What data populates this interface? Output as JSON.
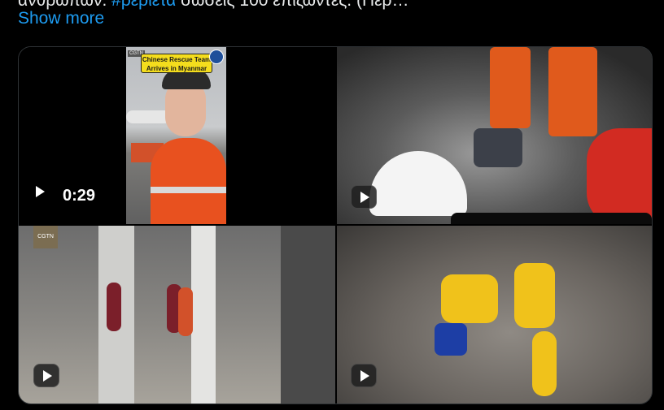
{
  "tweet": {
    "partial_line_start": "ανθρώπων.",
    "partial_link": "#ρεριετα",
    "partial_line_end": "σώσεις 100 επιζώντες. (Περ…",
    "show_more_label": "Show more"
  },
  "media": {
    "tile1": {
      "duration": "0:29",
      "banner_text": "Chinese Rescue Team Arrives in Myanmar",
      "logo": "CGTN"
    },
    "tile3": {
      "logo": "CGTN"
    }
  },
  "icons": {
    "play": "play-icon"
  },
  "colors": {
    "background": "#000000",
    "text": "#e7e9ea",
    "link": "#1d9bf0",
    "border": "#2f3336"
  }
}
